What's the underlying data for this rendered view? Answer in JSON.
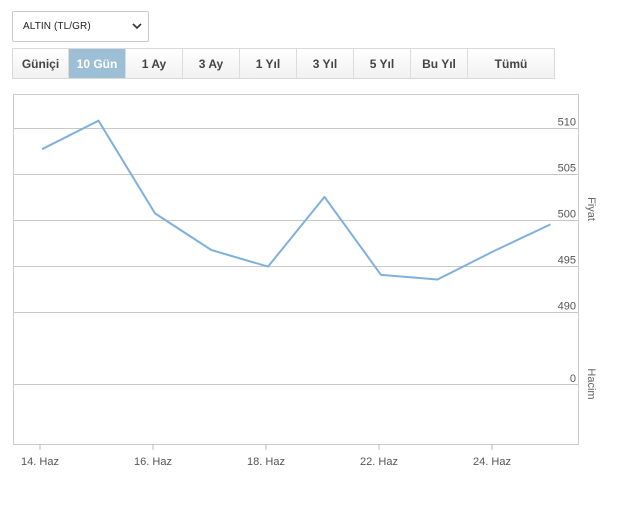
{
  "instrument_select": {
    "value": "ALTIN (TL/GR)"
  },
  "range_tabs": [
    {
      "label": "Güniçi",
      "active": false
    },
    {
      "label": "10 Gün",
      "active": true
    },
    {
      "label": "1 Ay",
      "active": false
    },
    {
      "label": "3 Ay",
      "active": false
    },
    {
      "label": "1 Yıl",
      "active": false
    },
    {
      "label": "3 Yıl",
      "active": false
    },
    {
      "label": "5 Yıl",
      "active": false
    },
    {
      "label": "Bu Yıl",
      "active": false
    },
    {
      "label": "Tümü",
      "active": false
    }
  ],
  "colors": {
    "line": "#7fb0dc",
    "active_tab": "#9cbfd5",
    "grid": "#c8c8c8",
    "frame": "#cccccc"
  },
  "chart_data": {
    "type": "line",
    "price_axis_label": "Fiyat",
    "volume_axis_label": "Hacim",
    "price_ticks": [
      "510",
      "505",
      "500",
      "495",
      "490"
    ],
    "volume_ticks": [
      "0"
    ],
    "x_tick_labels": [
      "14. Haz",
      "16. Haz",
      "18. Haz",
      "22. Haz",
      "24. Haz"
    ],
    "ylim": [
      485.6,
      513.6
    ],
    "series": [
      {
        "values": [
          507.7,
          510.8,
          500.7,
          496.7,
          494.9,
          502.5,
          494.0,
          493.5,
          496.6,
          499.5
        ]
      }
    ],
    "grid": true
  }
}
